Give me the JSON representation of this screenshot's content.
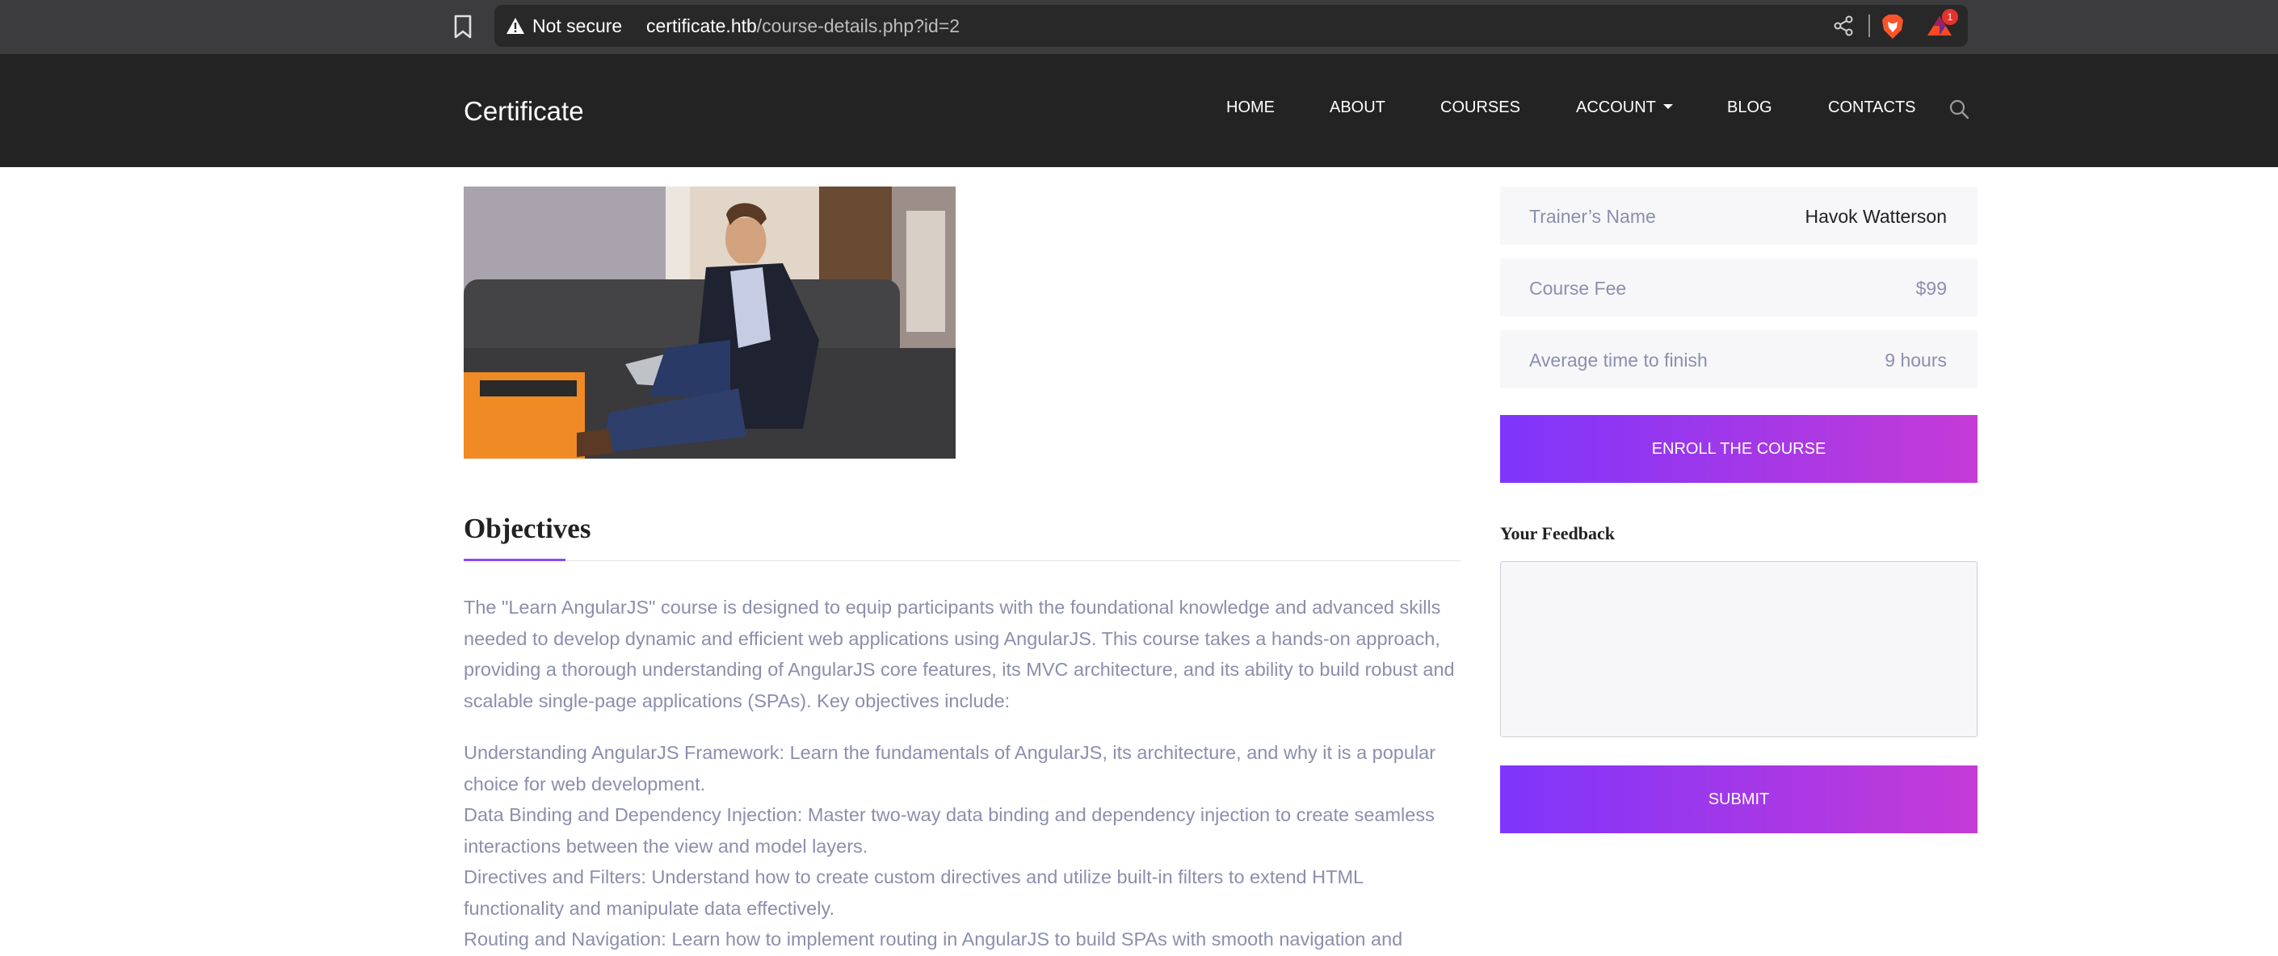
{
  "browser": {
    "security_label": "Not secure",
    "url_host": "certificate.htb",
    "url_path": "/course-details.php?id=2",
    "rewards_badge": "1"
  },
  "site": {
    "logo": "Certificate",
    "nav": [
      "HOME",
      "ABOUT",
      "COURSES",
      "ACCOUNT",
      "BLOG",
      "CONTACTS"
    ]
  },
  "course": {
    "details": [
      {
        "label": "Trainer’s Name",
        "value": "Havok Watterson"
      },
      {
        "label": "Course Fee",
        "value": "$99"
      },
      {
        "label": "Average time to finish",
        "value": "9 hours"
      }
    ],
    "enroll_label": "ENROLL THE COURSE",
    "feedback_title": "Your Feedback",
    "submit_label": "SUBMIT"
  },
  "objectives": {
    "title": "Objectives",
    "intro": "The \"Learn AngularJS\" course is designed to equip participants with the foundational knowledge and advanced skills needed to develop dynamic and efficient web applications using AngularJS. This course takes a hands-on approach, providing a thorough understanding of AngularJS core features, its MVC architecture, and its ability to build robust and scalable single-page applications (SPAs). Key objectives include:",
    "items": [
      "Understanding AngularJS Framework: Learn the fundamentals of AngularJS, its architecture, and why it is a popular choice for web development.",
      "Data Binding and Dependency Injection: Master two-way data binding and dependency injection to create seamless interactions between the view and model layers.",
      "Directives and Filters: Understand how to create custom directives and utilize built-in filters to extend HTML functionality and manipulate data effectively.",
      "Routing and Navigation: Learn how to implement routing in AngularJS to build SPAs with smooth navigation and"
    ]
  },
  "colors": {
    "header_bg": "#232323",
    "accent_start": "#7e35fb",
    "accent_end": "#c53bd6",
    "body_text": "#8a8fac"
  },
  "icons": {
    "bookmark": "bookmark-icon",
    "warning": "warning-icon",
    "share": "share-icon",
    "brave": "brave-lion-icon",
    "rewards": "brave-rewards-icon",
    "search": "search-icon",
    "caret": "caret-down-icon"
  }
}
